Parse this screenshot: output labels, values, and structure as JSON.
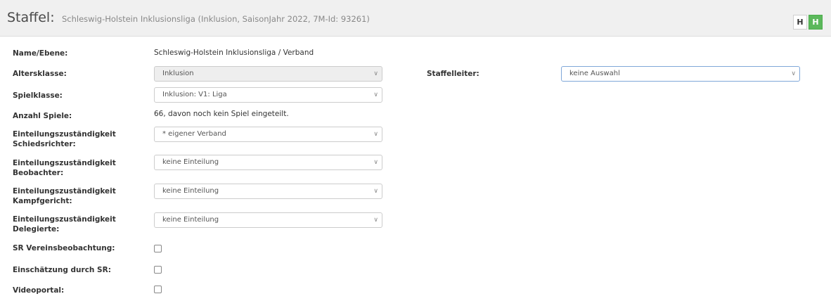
{
  "header": {
    "title": "Staffel:",
    "subtitle": "Schleswig-Holstein Inklusionsliga (Inklusion, SaisonJahr 2022, 7M-Id: 93261)",
    "btn_a": "H",
    "btn_b": "H"
  },
  "form": {
    "name_label": "Name/Ebene:",
    "name_value": "Schleswig-Holstein Inklusionsliga / Verband",
    "altersklasse_label": "Altersklasse:",
    "altersklasse_value": "Inklusion",
    "staffelleiter_label": "Staffelleiter:",
    "staffelleiter_value": "keine Auswahl",
    "spielklasse_label": "Spielklasse:",
    "spielklasse_value": "Inklusion: V1: Liga",
    "anzahl_label": "Anzahl Spiele:",
    "anzahl_value": "66, davon noch kein Spiel eingeteilt.",
    "ez_sr_label_1": "Einteilungszuständigkeit",
    "ez_sr_label_2": "Schiedsrichter:",
    "ez_sr_value": "* eigener Verband",
    "ez_beob_label_1": "Einteilungszuständigkeit",
    "ez_beob_label_2": "Beobachter:",
    "ez_beob_value": "keine Einteilung",
    "ez_kampf_label_1": "Einteilungszuständigkeit",
    "ez_kampf_label_2": "Kampfgericht:",
    "ez_kampf_value": "keine Einteilung",
    "ez_del_label_1": "Einteilungszuständigkeit",
    "ez_del_label_2": "Delegierte:",
    "ez_del_value": "keine Einteilung",
    "sr_vereins_label": "SR Vereinsbeobachtung:",
    "einschaetzung_label": "Einschätzung durch SR:",
    "videoportal_label": "Videoportal:",
    "sr_vereins_checked": false,
    "einschaetzung_checked": false,
    "videoportal_checked": false
  },
  "icons": {
    "dropdown": "chevron-down-icon"
  },
  "colors": {
    "header_bg": "#f0f0f0",
    "green_button": "#5cb85c"
  }
}
